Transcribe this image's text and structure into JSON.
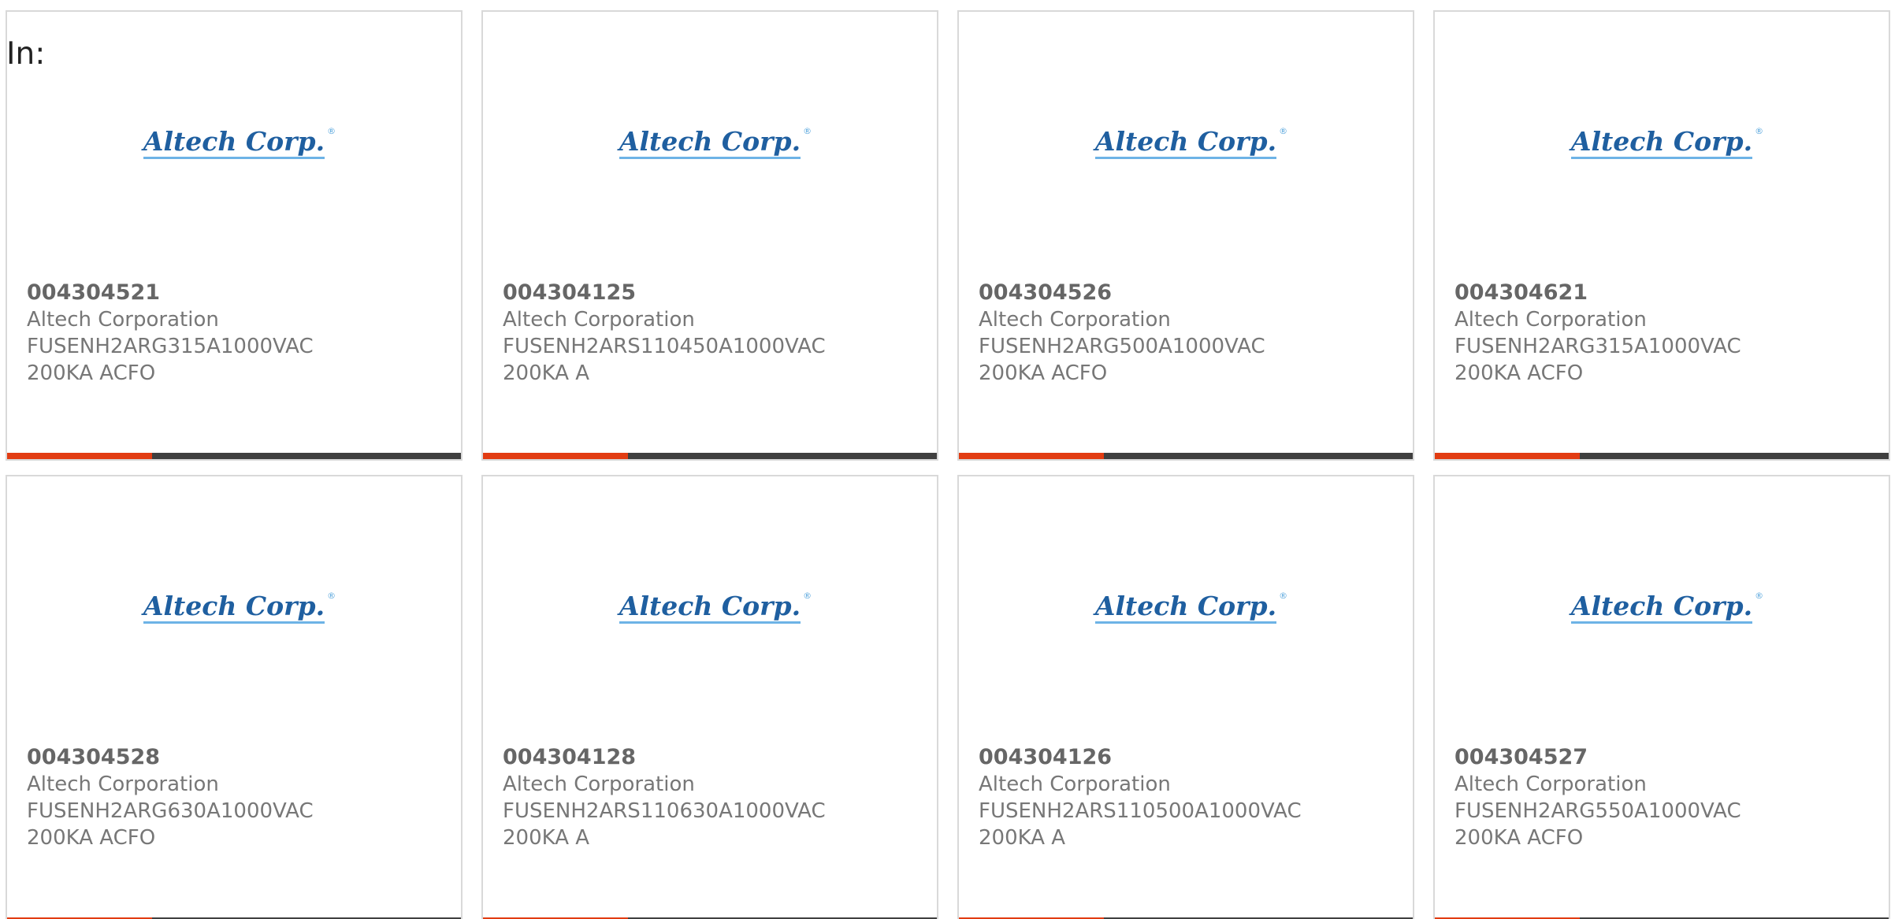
{
  "header": {
    "label": "In:"
  },
  "colors": {
    "accent": "#e23c12",
    "bar_track": "#3f3f3f",
    "logo_blue": "#1f5fa0",
    "text_gray": "#777777"
  },
  "logo": {
    "text": "Altech Corp.",
    "reg": "®"
  },
  "products": [
    {
      "part_number": "004304521",
      "manufacturer": "Altech Corporation",
      "desc_line1": "FUSENH2ARG315A1000VAC",
      "desc_line2": "200KA ACFO",
      "progress": 0.32
    },
    {
      "part_number": "004304125",
      "manufacturer": "Altech Corporation",
      "desc_line1": "FUSENH2ARS110450A1000VAC",
      "desc_line2": "200KA A",
      "progress": 0.32
    },
    {
      "part_number": "004304526",
      "manufacturer": "Altech Corporation",
      "desc_line1": "FUSENH2ARG500A1000VAC",
      "desc_line2": "200KA ACFO",
      "progress": 0.32
    },
    {
      "part_number": "004304621",
      "manufacturer": "Altech Corporation",
      "desc_line1": "FUSENH2ARG315A1000VAC",
      "desc_line2": "200KA ACFO",
      "progress": 0.32
    },
    {
      "part_number": "004304528",
      "manufacturer": "Altech Corporation",
      "desc_line1": "FUSENH2ARG630A1000VAC",
      "desc_line2": "200KA ACFO",
      "progress": 0.32
    },
    {
      "part_number": "004304128",
      "manufacturer": "Altech Corporation",
      "desc_line1": "FUSENH2ARS110630A1000VAC",
      "desc_line2": "200KA A",
      "progress": 0.32
    },
    {
      "part_number": "004304126",
      "manufacturer": "Altech Corporation",
      "desc_line1": "FUSENH2ARS110500A1000VAC",
      "desc_line2": "200KA A",
      "progress": 0.32
    },
    {
      "part_number": "004304527",
      "manufacturer": "Altech Corporation",
      "desc_line1": "FUSENH2ARG550A1000VAC",
      "desc_line2": "200KA ACFO",
      "progress": 0.32
    }
  ]
}
